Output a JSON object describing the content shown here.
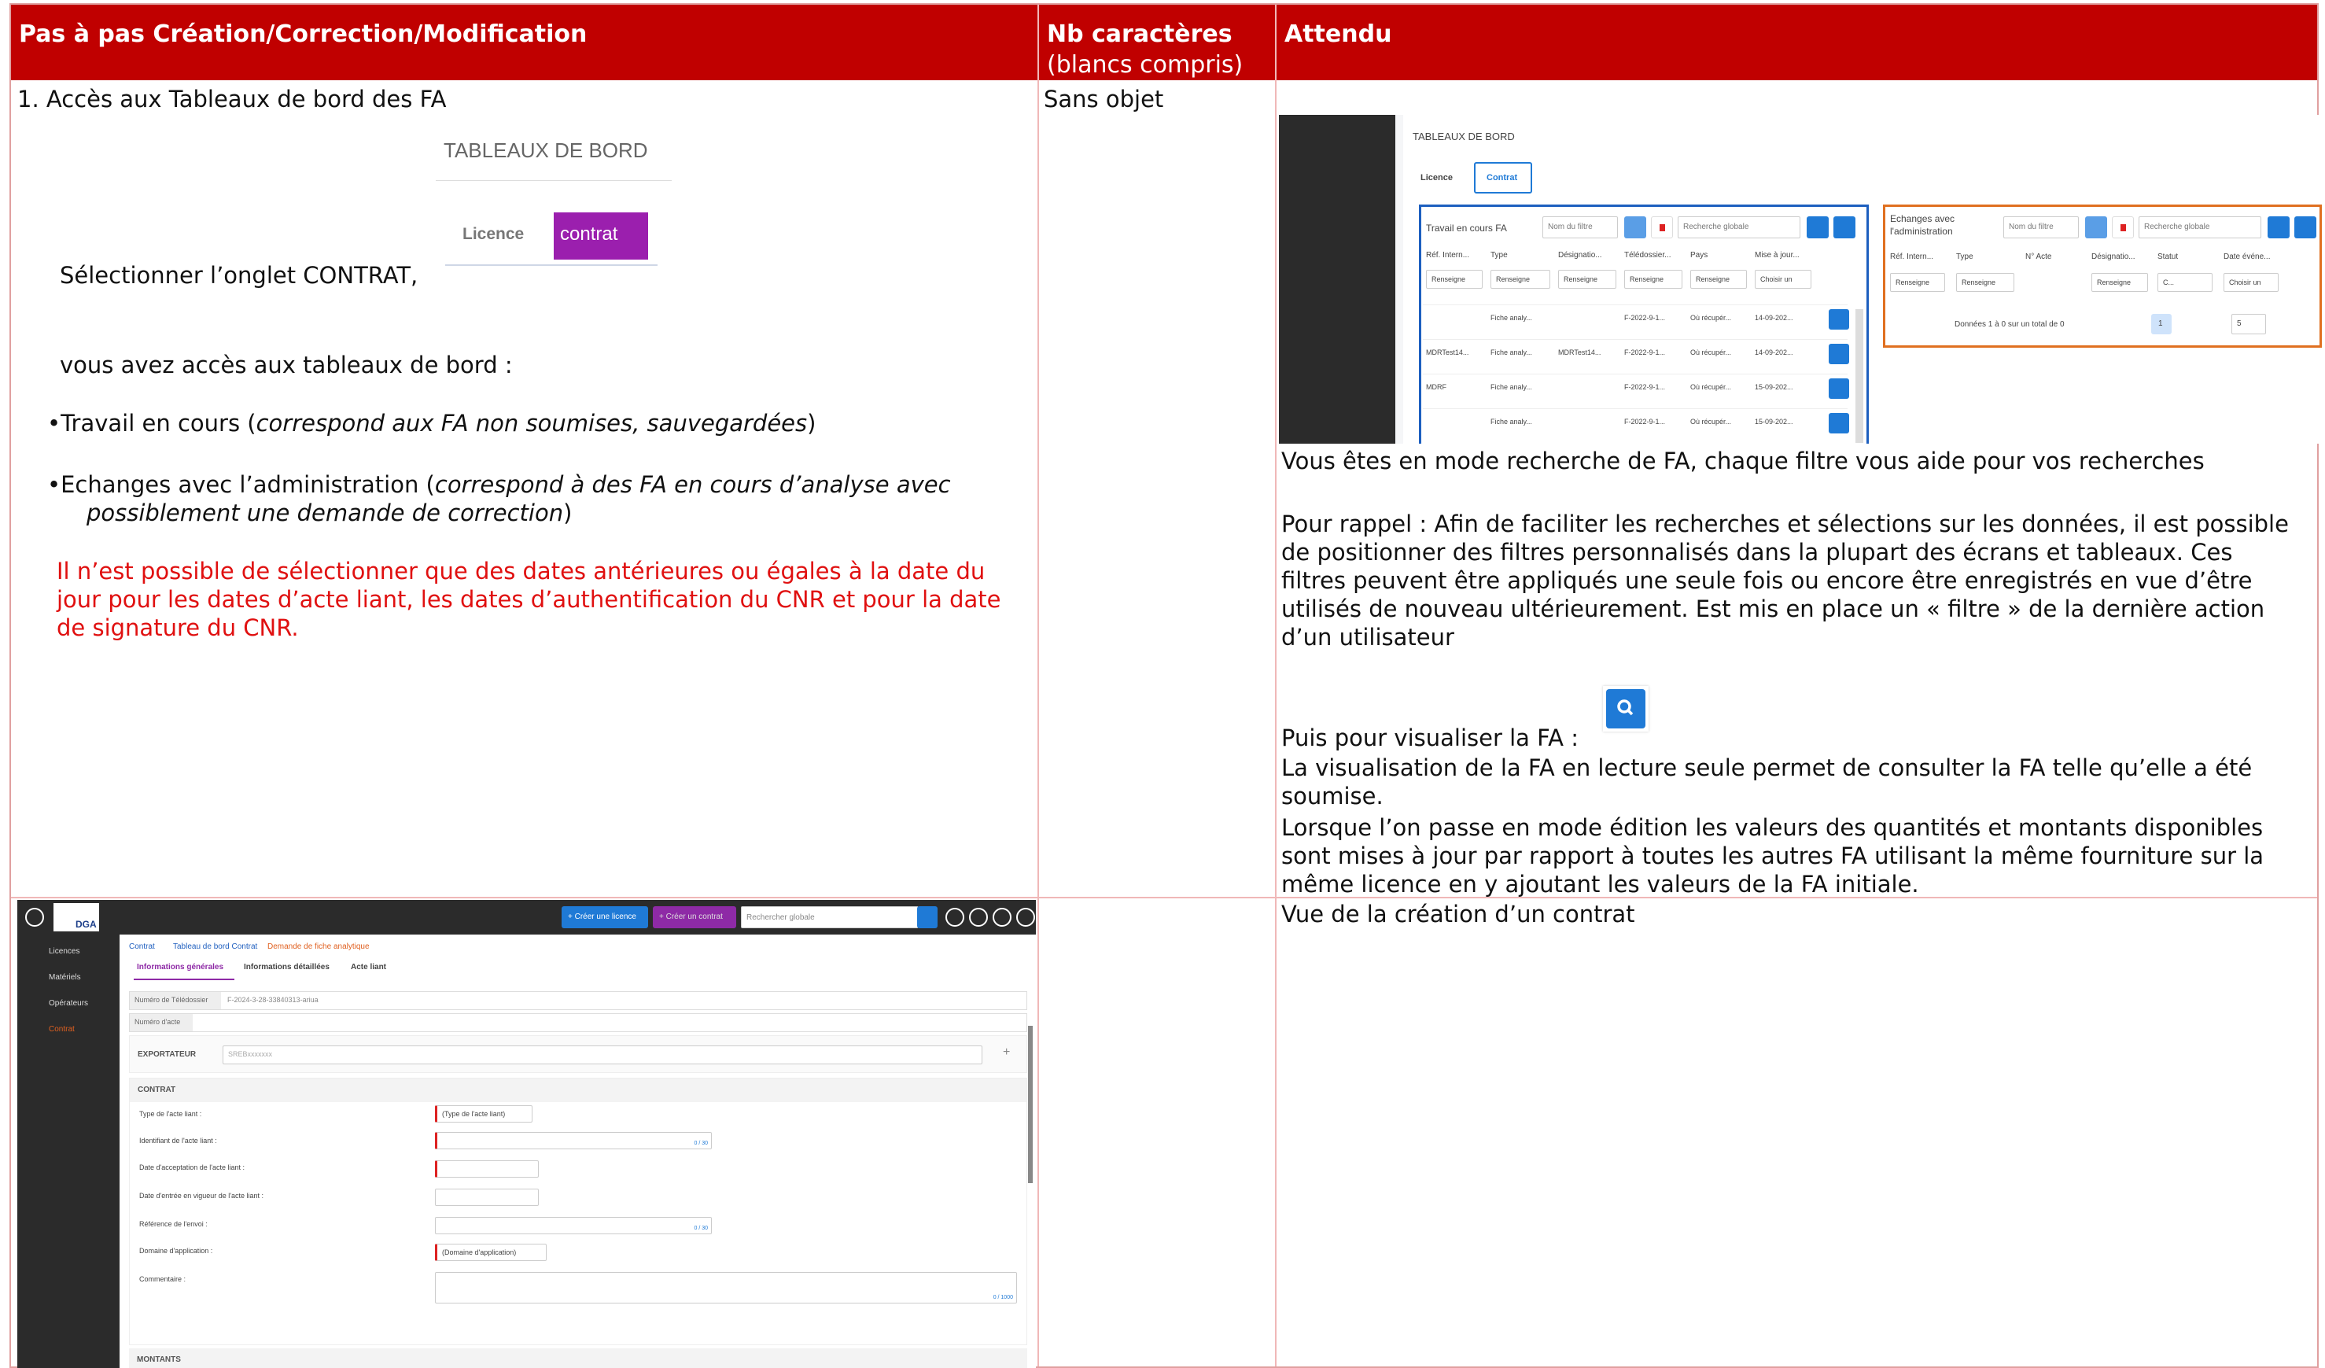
{
  "headers": {
    "col1": "Pas à pas Création/Correction/Modification",
    "col2_main": "Nb caractères",
    "col2_sub": "(blancs compris)",
    "col3": "Attendu"
  },
  "row1": {
    "step": "1.   Accès aux Tableaux de bord des FA",
    "tableaux_img": "TABLEAUX DE BORD",
    "tab_licence": "Licence",
    "tab_contrat": "contrat",
    "select_tab": "Sélectionner l’onglet CONTRAT,",
    "access": "vous avez accès aux tableaux de bord :",
    "bullet1_a": "•Travail en cours (",
    "bullet1_b": "correspond aux FA non soumises, sauvegardées",
    "bullet1_c": ")",
    "bullet2_a": "•Echanges avec l’administration (",
    "bullet2_b": "correspond à des FA en cours d’analyse avec",
    "bullet2_c": "possiblement une demande de correction",
    "bullet2_d": ")",
    "warn1": "Il n’est possible de sélectionner que des dates antérieures ou égales à la date du",
    "warn2": "jour pour les dates d’acte liant, les dates d’authentification du CNR et pour la date",
    "warn3": "de signature du CNR.",
    "nb": "Sans objet",
    "attendu_search": "Vous êtes en mode recherche de FA, chaque filtre vous aide pour vos recherches",
    "rappel": [
      "Pour rappel : Afin de faciliter les recherches et sélections sur les données, il est possible",
      "de positionner des filtres personnalisés dans la plupart des écrans et tableaux. Ces",
      "filtres peuvent être appliqués une seule fois ou encore être enregistrés en vue d’être",
      "utilisés de nouveau ultérieurement. Est mis en place un « filtre » de la dernière action",
      "d’un utilisateur"
    ],
    "visualiser": "Puis pour visualiser la FA :",
    "lecture": [
      "La visualisation de la FA en lecture seule permet de consulter la FA telle qu’elle a été",
      "soumise.",
      "Lorsque l’on passe en mode édition les valeurs des quantités et montants disponibles",
      "sont mises à jour par rapport à toutes les autres FA utilisant la même fourniture sur la",
      "même licence en y ajoutant les valeurs de la FA initiale."
    ]
  },
  "dashboard": {
    "title": "TABLEAUX DE BORD",
    "tab_licence": "Licence",
    "tab_contrat": "Contrat",
    "panel1_title": "Travail en cours FA",
    "panel2_title_1": "Echanges avec",
    "panel2_title_2": "l'administration",
    "filter_placeholder": "Nom du filtre",
    "global_search": "Recherche globale",
    "cols1": [
      "Réf. Intern...",
      "Type",
      "Désignatio...",
      "Télédossier...",
      "Pays",
      "Mise à jour..."
    ],
    "cols2": [
      "Réf. Intern...",
      "Type",
      "N° Acte",
      "Désignatio...",
      "Statut",
      "Date événe..."
    ],
    "renseigne": "Renseigne",
    "choisir": "Choisir un",
    "rows": [
      [
        "",
        "Fiche analy...",
        "",
        "F-2022-9-1...",
        "Où récupér...",
        "14-09-202..."
      ],
      [
        "MDRTest14...",
        "Fiche analy...",
        "MDRTest14...",
        "F-2022-9-1...",
        "Où récupér...",
        "14-09-202..."
      ],
      [
        "MDRF",
        "Fiche analy...",
        "",
        "F-2022-9-1...",
        "Où récupér...",
        "15-09-202..."
      ],
      [
        "",
        "Fiche analy...",
        "",
        "F-2022-9-1...",
        "Où récupér...",
        "15-09-202..."
      ]
    ],
    "pager": "Données 1 à 0 sur un total de 0",
    "page": "1",
    "page_size": "5",
    "statut_sel": "C..."
  },
  "row2": {
    "attendu": "Vue de la création d’un contrat"
  },
  "creation": {
    "btn_licence": "+ Créer une licence",
    "btn_contrat": "+ Créer un contrat",
    "search": "Rechercher globale",
    "side": [
      "Licences",
      "Matériels",
      "Opérateurs",
      "Contrat"
    ],
    "breadcrumb": [
      "Contrat",
      "Tableau de bord Contrat",
      "Demande de fiche analytique"
    ],
    "tabs": [
      "Informations générales",
      "Informations détaillées",
      "Acte liant"
    ],
    "num_tele_label": "Numéro de Télédossier",
    "num_tele_value": "F-2024-3-28-33840313-ariua",
    "num_acte_label": "Numéro d'acte",
    "exportateur": "EXPORTATEUR",
    "exportateur_ph": "SREBxxxxxxx",
    "contrat": "CONTRAT",
    "fields": [
      "Type de l'acte liant :",
      "Identifiant de l'acte liant :",
      "Date d'acceptation de l'acte liant :",
      "Date d'entrée en vigueur de l'acte liant :",
      "Référence de l'envoi :",
      "Domaine d'application :",
      "Commentaire :"
    ],
    "type_sel": "(Type de l'acte liant)",
    "domaine_sel": "(Domaine d'application)",
    "count1": "0 / 30",
    "count2": "0 / 30",
    "count3": "0 / 1000",
    "montants": "MONTANTS",
    "logo": "DGA"
  }
}
